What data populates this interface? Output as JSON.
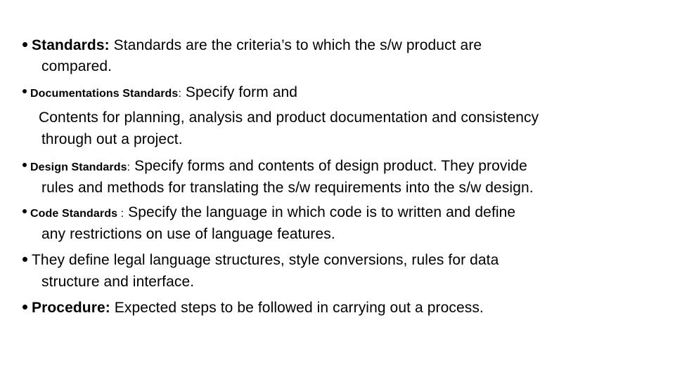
{
  "slide": {
    "bullets": [
      {
        "term": "Standards:",
        "text_line1": " Standards are the criteria’s to which the s/w product are",
        "text_line2": "compared."
      },
      {
        "term": "Documentations Standards",
        "separator": ":",
        "text_line1": " Specify form and",
        "text_line2": "Contents for planning, analysis and product documentation and consistency",
        "text_line3": "through out a project."
      },
      {
        "term": "Design Standards",
        "separator": ":",
        "text_line1": " Specify forms and contents of design product. They provide",
        "text_line2": "rules and methods for translating the s/w requirements into the s/w design."
      },
      {
        "term": "Code Standards",
        "separator": " :",
        "text_line1": " Specify the language in which code is to written and define",
        "text_line2": "any restrictions on use of language features."
      },
      {
        "text_line1": "They define legal language structures, style conversions, rules for data",
        "text_line2": "structure and interface."
      },
      {
        "term": "Procedure:",
        "text_line1": " Expected steps to be followed in carrying out a process."
      }
    ],
    "bullet_icon": "filled-circle"
  }
}
